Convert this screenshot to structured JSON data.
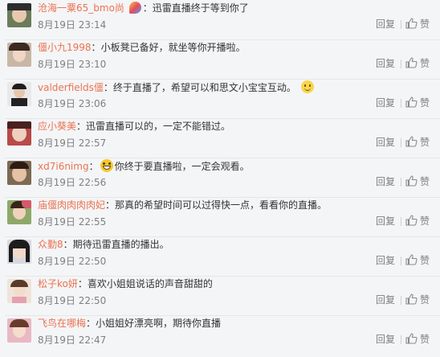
{
  "comments": [
    {
      "user": "沧海一粟65_bmo尚",
      "text": "迅雷直播终于等到你了",
      "time": "8月19日 23:14",
      "has_badge_icon": true,
      "emoji": null
    },
    {
      "user": "僵小九1998",
      "text": "小板凳已备好，就坐等你开播啦。",
      "time": "8月19日 23:10",
      "emoji": null
    },
    {
      "user": "valderfields僵",
      "text": "终于直播了，希望可以和思文小宝宝互动。",
      "time": "8月19日 23:06",
      "emoji": "smile-emoji"
    },
    {
      "user": "应小葵美",
      "text": "迅雷直播可以的，一定不能错过。",
      "time": "8月19日 22:57",
      "emoji": null
    },
    {
      "user": "xd7i6nimg",
      "text": "你终于要直播啦，一定会观看。",
      "time": "8月19日 22:56",
      "emoji": "grin-emoji"
    },
    {
      "user": "庙僵肉肉肉肉妃",
      "text": "那真的希望时间可以过得快一点，看看你的直播。",
      "time": "8月19日 22:55",
      "emoji": null
    },
    {
      "user": "众勤8",
      "text": "期待迅雷直播的播出。",
      "time": "8月19日 22:50",
      "emoji": null
    },
    {
      "user": "松子ko妍",
      "text": "喜欢小姐姐说话的声音甜甜的",
      "time": "8月19日 22:50",
      "emoji": null
    },
    {
      "user": "飞鸟在哪梅",
      "text": "小姐姐好漂亮啊，期待你直播",
      "time": "8月19日 22:47",
      "emoji": null
    }
  ],
  "labels": {
    "reply": "回复",
    "like": "赞",
    "colon": "："
  },
  "colors": {
    "username": "#eb7350",
    "meta": "#808080",
    "background": "#f4f5f7"
  }
}
